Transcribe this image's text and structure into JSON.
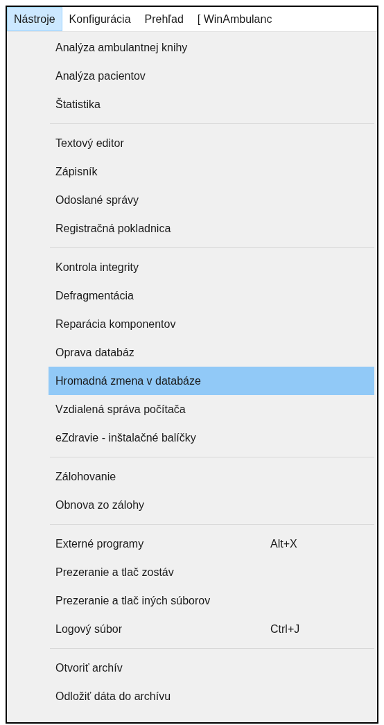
{
  "menubar": [
    {
      "label": "Nástroje",
      "selected": true
    },
    {
      "label": "Konfigurácia",
      "selected": false
    },
    {
      "label": "Prehľad",
      "selected": false
    },
    {
      "label": "[ WinAmbulanc",
      "selected": false
    }
  ],
  "menu": {
    "groups": [
      [
        {
          "label": "Analýza ambulantnej knihy",
          "highlighted": false
        },
        {
          "label": "Analýza pacientov",
          "highlighted": false
        },
        {
          "label": "Štatistika",
          "highlighted": false
        }
      ],
      [
        {
          "label": "Textový editor",
          "highlighted": false
        },
        {
          "label": "Zápisník",
          "highlighted": false
        },
        {
          "label": "Odoslané správy",
          "highlighted": false
        },
        {
          "label": "Registračná pokladnica",
          "highlighted": false
        }
      ],
      [
        {
          "label": "Kontrola integrity",
          "highlighted": false
        },
        {
          "label": "Defragmentácia",
          "highlighted": false
        },
        {
          "label": "Reparácia komponentov",
          "highlighted": false
        },
        {
          "label": "Oprava databáz",
          "highlighted": false
        },
        {
          "label": "Hromadná zmena v databáze",
          "highlighted": true
        },
        {
          "label": "Vzdialená správa počítača",
          "highlighted": false
        },
        {
          "label": "eZdravie - inštalačné balíčky",
          "highlighted": false
        }
      ],
      [
        {
          "label": "Zálohovanie",
          "highlighted": false
        },
        {
          "label": "Obnova zo zálohy",
          "highlighted": false
        }
      ],
      [
        {
          "label": "Externé programy",
          "shortcut": "Alt+X",
          "highlighted": false
        },
        {
          "label": "Prezeranie a tlač zostáv",
          "highlighted": false
        },
        {
          "label": "Prezeranie a tlač iných súborov",
          "highlighted": false
        },
        {
          "label": "Logový súbor",
          "shortcut": "Ctrl+J",
          "highlighted": false
        }
      ],
      [
        {
          "label": "Otvoriť archív",
          "highlighted": false
        },
        {
          "label": "Odložiť dáta do archívu",
          "highlighted": false
        }
      ]
    ]
  }
}
